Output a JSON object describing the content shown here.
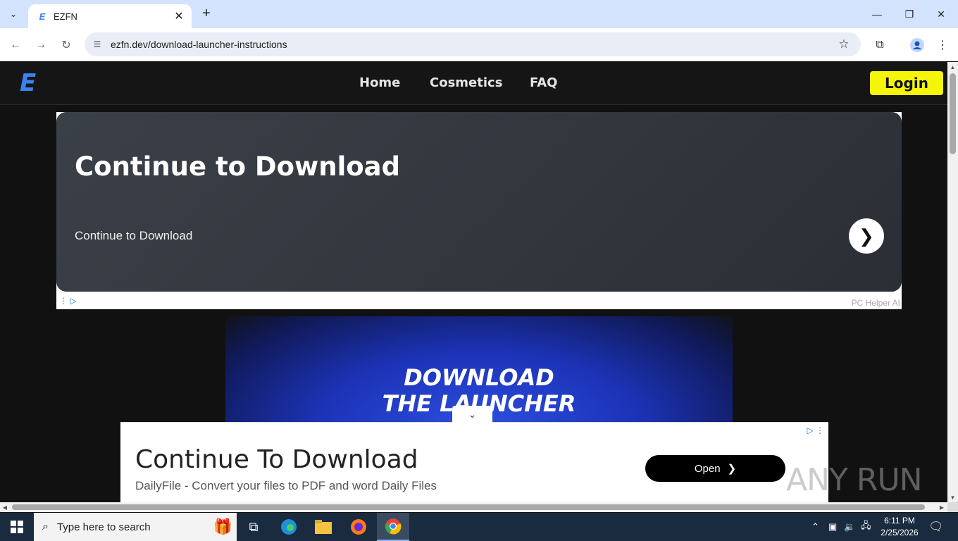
{
  "browser": {
    "tab_title": "EZFN",
    "url": "ezfn.dev/download-launcher-instructions",
    "favicon_letter": "E"
  },
  "site": {
    "logo": "E",
    "nav": [
      "Home",
      "Cosmetics",
      "FAQ"
    ],
    "login_label": "Login"
  },
  "ad_card": {
    "heading": "Continue to Download",
    "subtext": "Continue to Download",
    "sponsor": "PC Helper AI"
  },
  "hero": {
    "line1": "DOWNLOAD",
    "line2": "THE LAUNCHER"
  },
  "bottom_ad": {
    "heading": "Continue To Download",
    "subtext": "DailyFile - Convert your files to PDF and word Daily Files",
    "button": "Open"
  },
  "watermark": "ANY RUN",
  "taskbar": {
    "search_placeholder": "Type here to search",
    "time": "6:11 PM",
    "date": "2/25/2026"
  },
  "colors": {
    "accent_blue": "#3b82f6",
    "login_yellow": "#f5f50a",
    "hero_blue": "#2d4fe0"
  }
}
